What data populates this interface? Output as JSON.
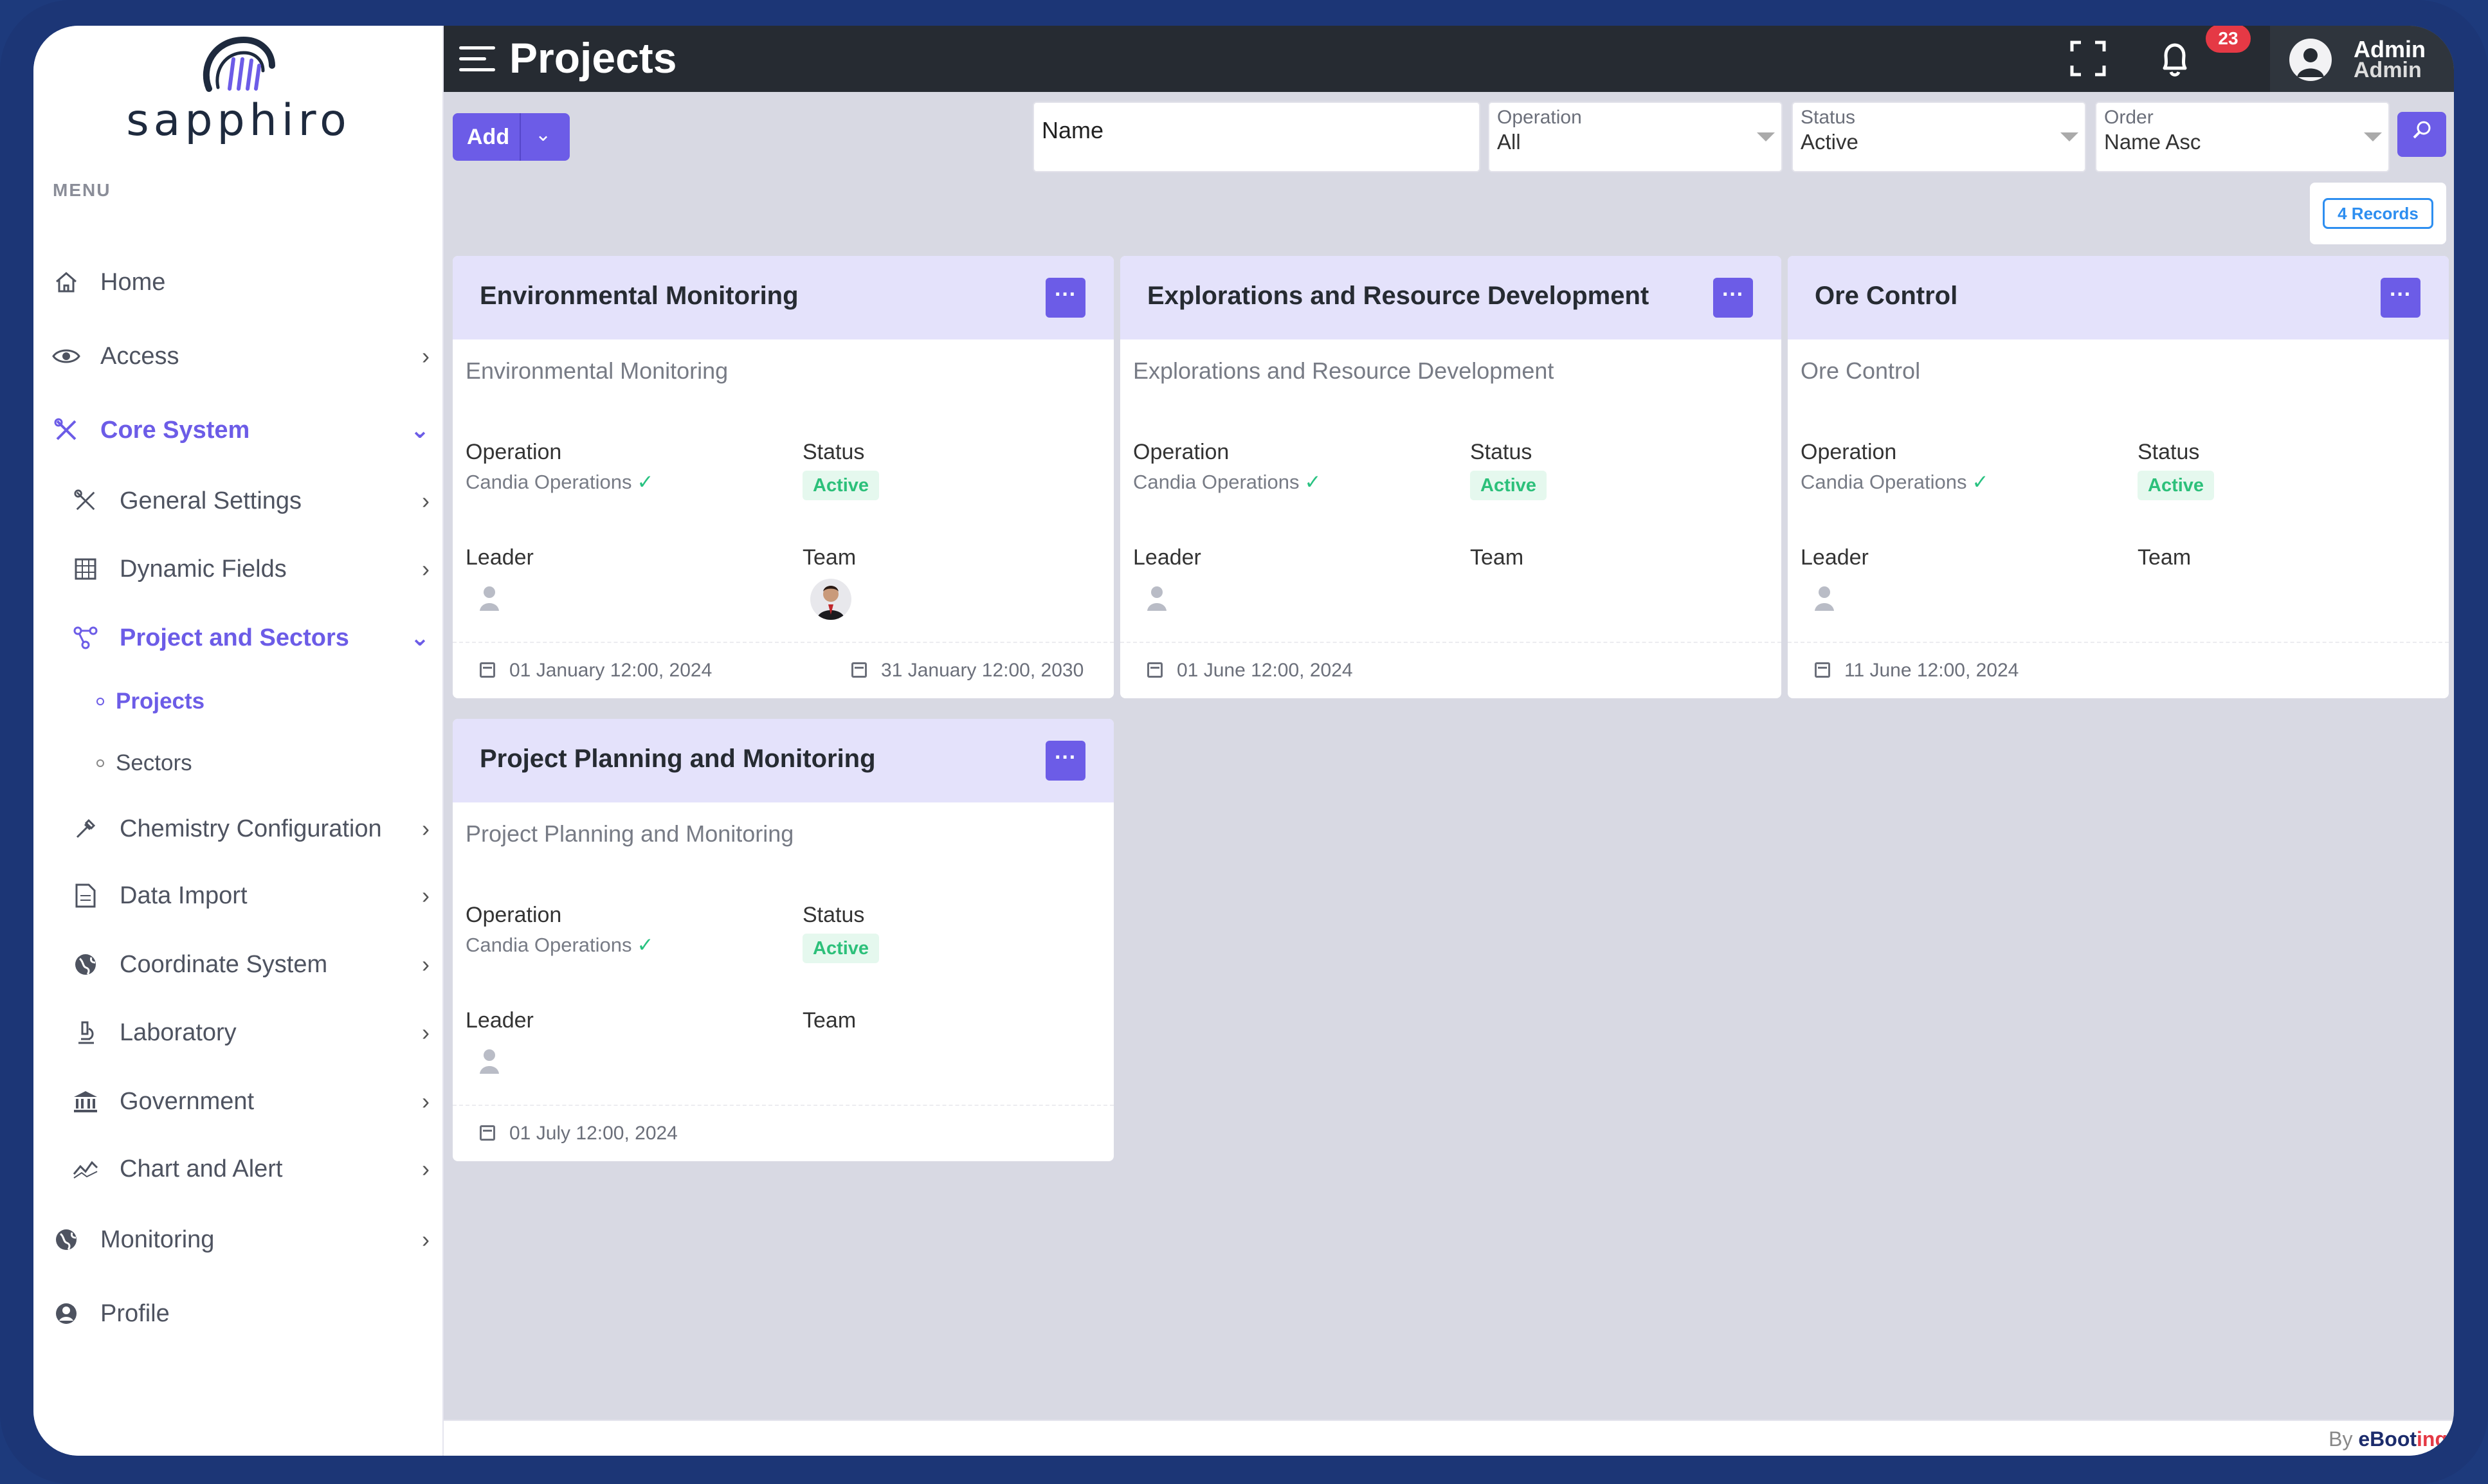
{
  "brand": {
    "name": "sapphiro"
  },
  "sidebar": {
    "menu_label": "MENU",
    "items": [
      {
        "label": "Home",
        "icon": "home-icon"
      },
      {
        "label": "Access",
        "icon": "eye-icon"
      },
      {
        "label": "Core System",
        "icon": "tools-icon"
      },
      {
        "label": "General Settings",
        "icon": "tools-icon"
      },
      {
        "label": "Dynamic Fields",
        "icon": "grid-icon"
      },
      {
        "label": "Project and Sectors",
        "icon": "nodes-icon"
      },
      {
        "label": "Projects"
      },
      {
        "label": "Sectors"
      },
      {
        "label": "Chemistry Configuration",
        "icon": "dropper-icon"
      },
      {
        "label": "Data Import",
        "icon": "file-icon"
      },
      {
        "label": "Coordinate System",
        "icon": "globe-icon"
      },
      {
        "label": "Laboratory",
        "icon": "microscope-icon"
      },
      {
        "label": "Government",
        "icon": "bank-icon"
      },
      {
        "label": "Chart and Alert",
        "icon": "chart-icon"
      },
      {
        "label": "Monitoring",
        "icon": "globe-icon"
      },
      {
        "label": "Profile",
        "icon": "user-circle-icon"
      }
    ]
  },
  "header": {
    "title": "Projects",
    "notifications": "23",
    "user_name": "Admin",
    "user_role": "Admin"
  },
  "toolbar": {
    "add_label": "Add",
    "name_placeholder": "Name",
    "operation": {
      "label": "Operation",
      "value": "All"
    },
    "status": {
      "label": "Status",
      "value": "Active"
    },
    "order": {
      "label": "Order",
      "value": "Name Asc"
    },
    "records": "4 Records"
  },
  "cards": [
    {
      "title": "Environmental Monitoring",
      "description": "Environmental Monitoring",
      "operation_label": "Operation",
      "operation": "Candia Operations",
      "status_label": "Status",
      "status": "Active",
      "leader_label": "Leader",
      "team_label": "Team",
      "start": "01 January 12:00, 2024",
      "end": "31 January 12:00, 2030"
    },
    {
      "title": "Explorations and Resource Development",
      "description": "Explorations and Resource Development",
      "operation_label": "Operation",
      "operation": "Candia Operations",
      "status_label": "Status",
      "status": "Active",
      "leader_label": "Leader",
      "team_label": "Team",
      "start": "01 June 12:00, 2024"
    },
    {
      "title": "Ore Control",
      "description": "Ore Control",
      "operation_label": "Operation",
      "operation": "Candia Operations",
      "status_label": "Status",
      "status": "Active",
      "leader_label": "Leader",
      "team_label": "Team",
      "start": "11 June 12:00, 2024"
    },
    {
      "title": "Project Planning and Monitoring",
      "description": "Project Planning and Monitoring",
      "operation_label": "Operation",
      "operation": "Candia Operations",
      "status_label": "Status",
      "status": "Active",
      "leader_label": "Leader",
      "team_label": "Team",
      "start": "01 July 12:00, 2024"
    }
  ],
  "footer": {
    "by": "By",
    "brand_a": "eBoot",
    "brand_b": "ing"
  },
  "colors": {
    "accent": "#6c5ce7",
    "topbar": "#262b32",
    "active_status": "#2cc07a",
    "frame": "#1c3676"
  }
}
